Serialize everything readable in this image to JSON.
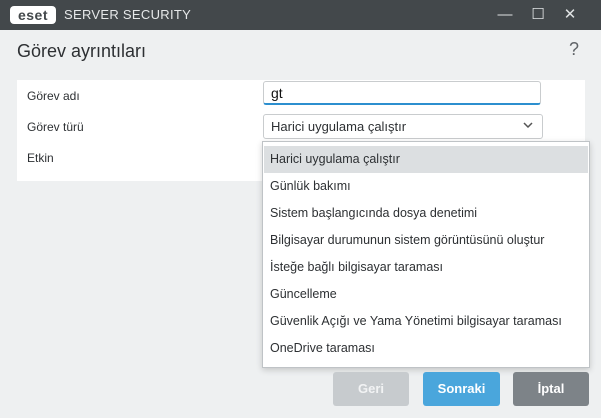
{
  "titlebar": {
    "logo": "eset",
    "app_name": "SERVER SECURITY",
    "minimize": "—",
    "maximize": "☐",
    "close": "✕"
  },
  "header": {
    "title": "Görev ayrıntıları",
    "help": "?"
  },
  "form": {
    "task_name_label": "Görev adı",
    "task_name_value": "gt",
    "task_type_label": "Görev türü",
    "task_type_value": "Harici uygulama çalıştır",
    "enabled_label": "Etkin"
  },
  "dropdown": {
    "options": [
      "Harici uygulama çalıştır",
      "Günlük bakımı",
      "Sistem başlangıcında dosya denetimi",
      "Bilgisayar durumunun sistem görüntüsünü oluştur",
      "İsteğe bağlı bilgisayar taraması",
      "Güncelleme",
      "Güvenlik Açığı ve Yama Yönetimi bilgisayar taraması",
      "OneDrive taraması"
    ],
    "selected_index": 0
  },
  "buttons": {
    "back": "Geri",
    "next": "Sonraki",
    "cancel": "İptal"
  },
  "colors": {
    "titlebar": "#43484b",
    "accent": "#4aa6dc",
    "cancel": "#7d8388",
    "disabled": "#c7cbce"
  }
}
